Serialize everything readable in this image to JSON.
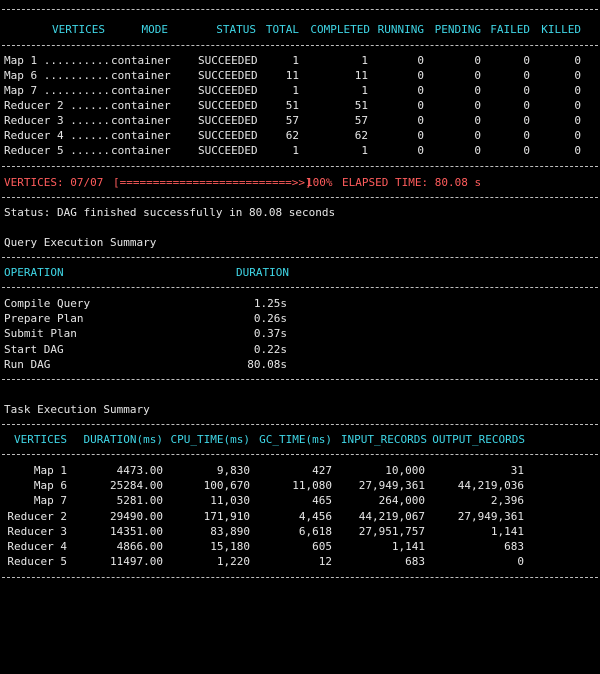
{
  "vertices": {
    "headers": {
      "vertices": "VERTICES",
      "mode": "MODE",
      "status": "STATUS",
      "total": "TOTAL",
      "completed": "COMPLETED",
      "running": "RUNNING",
      "pending": "PENDING",
      "failed": "FAILED",
      "killed": "KILLED"
    },
    "rows": [
      {
        "name": "Map 1 ..........",
        "mode": "container",
        "status": "SUCCEEDED",
        "total": "1",
        "completed": "1",
        "running": "0",
        "pending": "0",
        "failed": "0",
        "killed": "0"
      },
      {
        "name": "Map 6 ..........",
        "mode": "container",
        "status": "SUCCEEDED",
        "total": "11",
        "completed": "11",
        "running": "0",
        "pending": "0",
        "failed": "0",
        "killed": "0"
      },
      {
        "name": "Map 7 ..........",
        "mode": "container",
        "status": "SUCCEEDED",
        "total": "1",
        "completed": "1",
        "running": "0",
        "pending": "0",
        "failed": "0",
        "killed": "0"
      },
      {
        "name": "Reducer 2 ......",
        "mode": "container",
        "status": "SUCCEEDED",
        "total": "51",
        "completed": "51",
        "running": "0",
        "pending": "0",
        "failed": "0",
        "killed": "0"
      },
      {
        "name": "Reducer 3 ......",
        "mode": "container",
        "status": "SUCCEEDED",
        "total": "57",
        "completed": "57",
        "running": "0",
        "pending": "0",
        "failed": "0",
        "killed": "0"
      },
      {
        "name": "Reducer 4 ......",
        "mode": "container",
        "status": "SUCCEEDED",
        "total": "62",
        "completed": "62",
        "running": "0",
        "pending": "0",
        "failed": "0",
        "killed": "0"
      },
      {
        "name": "Reducer 5 ......",
        "mode": "container",
        "status": "SUCCEEDED",
        "total": "1",
        "completed": "1",
        "running": "0",
        "pending": "0",
        "failed": "0",
        "killed": "0"
      }
    ]
  },
  "progress": {
    "vertices_label": "VERTICES: 07/07",
    "bar": "[==========================>>]",
    "percent": "100%",
    "elapsed": "ELAPSED TIME: 80.08 s"
  },
  "status_line": "Status: DAG finished successfully in 80.08 seconds",
  "query_summary": {
    "title": "Query Execution Summary",
    "headers": {
      "operation": "OPERATION",
      "duration": "DURATION"
    },
    "rows": [
      {
        "operation": "Compile Query",
        "duration": "1.25s"
      },
      {
        "operation": "Prepare Plan",
        "duration": "0.26s"
      },
      {
        "operation": "Submit Plan",
        "duration": "0.37s"
      },
      {
        "operation": "Start DAG",
        "duration": "0.22s"
      },
      {
        "operation": "Run DAG",
        "duration": "80.08s"
      }
    ]
  },
  "task_summary": {
    "title": "Task Execution Summary",
    "headers": {
      "vertices": "VERTICES",
      "duration": "DURATION(ms)",
      "cpu": "CPU_TIME(ms)",
      "gc": "GC_TIME(ms)",
      "input": "INPUT_RECORDS",
      "output": "OUTPUT_RECORDS"
    },
    "rows": [
      {
        "vertex": "Map 1",
        "duration": "4473.00",
        "cpu": "9,830",
        "gc": "427",
        "input": "10,000",
        "output": "31"
      },
      {
        "vertex": "Map 6",
        "duration": "25284.00",
        "cpu": "100,670",
        "gc": "11,080",
        "input": "27,949,361",
        "output": "44,219,036"
      },
      {
        "vertex": "Map 7",
        "duration": "5281.00",
        "cpu": "11,030",
        "gc": "465",
        "input": "264,000",
        "output": "2,396"
      },
      {
        "vertex": "Reducer 2",
        "duration": "29490.00",
        "cpu": "171,910",
        "gc": "4,456",
        "input": "44,219,067",
        "output": "27,949,361"
      },
      {
        "vertex": "Reducer 3",
        "duration": "14351.00",
        "cpu": "83,890",
        "gc": "6,618",
        "input": "27,951,757",
        "output": "1,141"
      },
      {
        "vertex": "Reducer 4",
        "duration": "4866.00",
        "cpu": "15,180",
        "gc": "605",
        "input": "1,141",
        "output": "683"
      },
      {
        "vertex": "Reducer 5",
        "duration": "11497.00",
        "cpu": "1,220",
        "gc": "12",
        "input": "683",
        "output": "0"
      }
    ]
  }
}
